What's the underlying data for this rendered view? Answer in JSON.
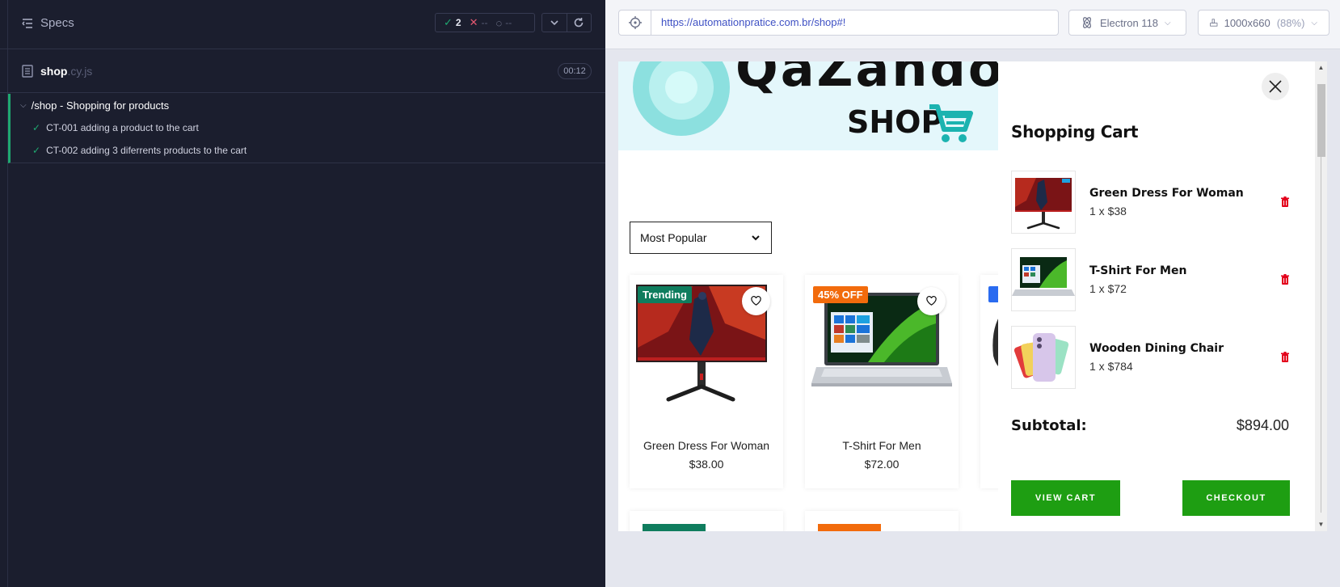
{
  "reporter": {
    "title": "Specs",
    "stats": {
      "passed": "2",
      "failed": "--",
      "pending": "--"
    },
    "file": {
      "name": "shop",
      "ext": ".cy.js",
      "duration": "00:12"
    },
    "suite": {
      "title": "/shop - Shopping for products",
      "tests": [
        {
          "title": "CT-001 adding a product to the cart",
          "state": "passed"
        },
        {
          "title": "CT-002 adding 3 diferrents products to the cart",
          "state": "passed"
        }
      ]
    }
  },
  "browser": {
    "url": "https://automationpratice.com.br/shop#!",
    "engine": "Electron 118",
    "viewport": "1000x660",
    "zoom": "(88%)"
  },
  "shop": {
    "brand_top": "QaZando",
    "brand_shop": "SHOP",
    "sort": "Most Popular",
    "products": [
      {
        "badge": "Trending",
        "name": "Green Dress For Woman",
        "price": "$38.00"
      },
      {
        "badge": "45% OFF",
        "name": "T-Shirt For Men",
        "price": "$72.00"
      }
    ]
  },
  "cart": {
    "title": "Shopping Cart",
    "items": [
      {
        "name": "Green Dress For Woman",
        "qty": "1 x $38"
      },
      {
        "name": "T-Shirt For Men",
        "qty": "1 x $72"
      },
      {
        "name": "Wooden Dining Chair",
        "qty": "1 x $784"
      }
    ],
    "subtotal_label": "Subtotal:",
    "subtotal_value": "$894.00",
    "view_cart": "VIEW CART",
    "checkout": "CHECKOUT"
  },
  "colors": {
    "reporter_bg": "#1b1e2e",
    "pass": "#1fa971",
    "fail": "#e45770",
    "cart_button": "#1e9e12",
    "url": "#3f51c4"
  },
  "icons": [
    "specs-icon",
    "check-icon",
    "x-icon",
    "pending-icon",
    "chevron-down-icon",
    "refresh-icon",
    "file-icon",
    "crosshair-icon",
    "electron-icon",
    "viewport-icon",
    "heart-icon",
    "close-icon",
    "trash-icon",
    "cart-icon"
  ]
}
